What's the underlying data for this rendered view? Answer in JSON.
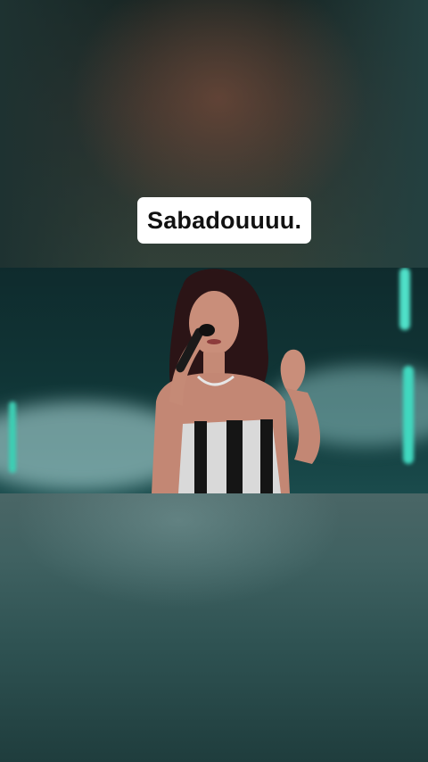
{
  "caption": {
    "text": "Sabadouuuu."
  },
  "icons": {
    "video": "video-frame",
    "singer": "singer-illustration"
  },
  "colors": {
    "caption_bg": "#ffffff",
    "caption_text": "#111111",
    "stage_light": "#4fe0c8"
  }
}
